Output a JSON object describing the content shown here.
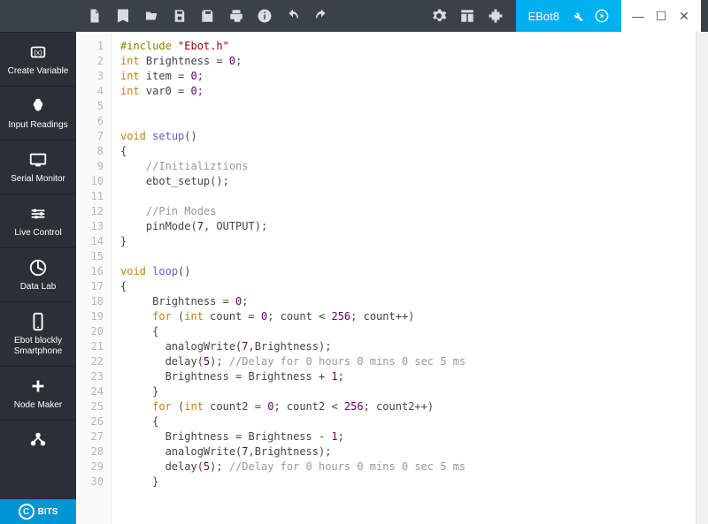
{
  "window_title": "EBot8",
  "sidebar": {
    "items": [
      {
        "label": "Create Variable"
      },
      {
        "label": "Input Readings"
      },
      {
        "label": "Serial Monitor"
      },
      {
        "label": "Live Control"
      },
      {
        "label": "Data Lab"
      },
      {
        "label": "Ebot blockly\nSmartphone"
      },
      {
        "label": "Node Maker"
      }
    ],
    "footer": "BITS"
  },
  "toolbar_icons": [
    "new-file",
    "book",
    "open",
    "save",
    "save-as",
    "print",
    "info",
    "undo",
    "redo"
  ],
  "toolbar_right": [
    "settings",
    "layout",
    "extension"
  ],
  "ebot_tab": {
    "label": "EBot8"
  },
  "code_lines": [
    {
      "n": 1,
      "seg": [
        {
          "c": "pp",
          "t": "#include"
        },
        {
          "t": " "
        },
        {
          "c": "str",
          "t": "\"Ebot.h\""
        }
      ]
    },
    {
      "n": 2,
      "seg": [
        {
          "c": "kw",
          "t": "int"
        },
        {
          "t": " Brightness = "
        },
        {
          "c": "num",
          "t": "0"
        },
        {
          "t": ";"
        }
      ]
    },
    {
      "n": 3,
      "seg": [
        {
          "c": "kw",
          "t": "int"
        },
        {
          "t": " item = "
        },
        {
          "c": "num",
          "t": "0"
        },
        {
          "t": ";"
        }
      ]
    },
    {
      "n": 4,
      "seg": [
        {
          "c": "kw",
          "t": "int"
        },
        {
          "t": " var0 = "
        },
        {
          "c": "num",
          "t": "0"
        },
        {
          "t": ";"
        }
      ]
    },
    {
      "n": 5,
      "seg": []
    },
    {
      "n": 6,
      "seg": []
    },
    {
      "n": 7,
      "seg": [
        {
          "c": "kw",
          "t": "void"
        },
        {
          "t": " "
        },
        {
          "c": "fn",
          "t": "setup"
        },
        {
          "t": "()"
        }
      ]
    },
    {
      "n": 8,
      "seg": [
        {
          "t": "{"
        }
      ]
    },
    {
      "n": 9,
      "seg": [
        {
          "t": "    "
        },
        {
          "c": "cm",
          "t": "//Initializtions"
        }
      ]
    },
    {
      "n": 10,
      "seg": [
        {
          "t": "    ebot_setup();"
        }
      ]
    },
    {
      "n": 11,
      "seg": []
    },
    {
      "n": 12,
      "seg": [
        {
          "t": "    "
        },
        {
          "c": "cm",
          "t": "//Pin Modes"
        }
      ]
    },
    {
      "n": 13,
      "seg": [
        {
          "t": "    pinMode("
        },
        {
          "c": "num",
          "t": "7"
        },
        {
          "t": ", OUTPUT);"
        }
      ]
    },
    {
      "n": 14,
      "seg": [
        {
          "t": "}"
        }
      ]
    },
    {
      "n": 15,
      "seg": []
    },
    {
      "n": 16,
      "seg": [
        {
          "c": "kw",
          "t": "void"
        },
        {
          "t": " "
        },
        {
          "c": "fn",
          "t": "loop"
        },
        {
          "t": "()"
        }
      ]
    },
    {
      "n": 17,
      "seg": [
        {
          "t": "{"
        }
      ]
    },
    {
      "n": 18,
      "seg": [
        {
          "t": "     Brightness = "
        },
        {
          "c": "num",
          "t": "0"
        },
        {
          "t": ";"
        }
      ]
    },
    {
      "n": 19,
      "seg": [
        {
          "t": "     "
        },
        {
          "c": "kw",
          "t": "for"
        },
        {
          "t": " ("
        },
        {
          "c": "kw",
          "t": "int"
        },
        {
          "t": " count = "
        },
        {
          "c": "num",
          "t": "0"
        },
        {
          "t": "; count < "
        },
        {
          "c": "num",
          "t": "256"
        },
        {
          "t": "; count++)"
        }
      ]
    },
    {
      "n": 20,
      "seg": [
        {
          "t": "     {"
        }
      ]
    },
    {
      "n": 21,
      "seg": [
        {
          "t": "       analogWrite("
        },
        {
          "c": "num",
          "t": "7"
        },
        {
          "t": ",Brightness);"
        }
      ]
    },
    {
      "n": 22,
      "seg": [
        {
          "t": "       delay("
        },
        {
          "c": "num",
          "t": "5"
        },
        {
          "t": "); "
        },
        {
          "c": "cm",
          "t": "//Delay for 0 hours 0 mins 0 sec 5 ms"
        }
      ]
    },
    {
      "n": 23,
      "seg": [
        {
          "t": "       Brightness = Brightness + "
        },
        {
          "c": "num",
          "t": "1"
        },
        {
          "t": ";"
        }
      ]
    },
    {
      "n": 24,
      "seg": [
        {
          "t": "     }"
        }
      ]
    },
    {
      "n": 25,
      "seg": [
        {
          "t": "     "
        },
        {
          "c": "kw",
          "t": "for"
        },
        {
          "t": " ("
        },
        {
          "c": "kw",
          "t": "int"
        },
        {
          "t": " count2 = "
        },
        {
          "c": "num",
          "t": "0"
        },
        {
          "t": "; count2 < "
        },
        {
          "c": "num",
          "t": "256"
        },
        {
          "t": "; count2++)"
        }
      ]
    },
    {
      "n": 26,
      "seg": [
        {
          "t": "     {"
        }
      ]
    },
    {
      "n": 27,
      "seg": [
        {
          "t": "       Brightness = Brightness - "
        },
        {
          "c": "num",
          "t": "1"
        },
        {
          "t": ";"
        }
      ]
    },
    {
      "n": 28,
      "seg": [
        {
          "t": "       analogWrite("
        },
        {
          "c": "num",
          "t": "7"
        },
        {
          "t": ",Brightness);"
        }
      ]
    },
    {
      "n": 29,
      "seg": [
        {
          "t": "       delay("
        },
        {
          "c": "num",
          "t": "5"
        },
        {
          "t": "); "
        },
        {
          "c": "cm",
          "t": "//Delay for 0 hours 0 mins 0 sec 5 ms"
        }
      ]
    },
    {
      "n": 30,
      "seg": [
        {
          "t": "     }"
        }
      ]
    }
  ]
}
